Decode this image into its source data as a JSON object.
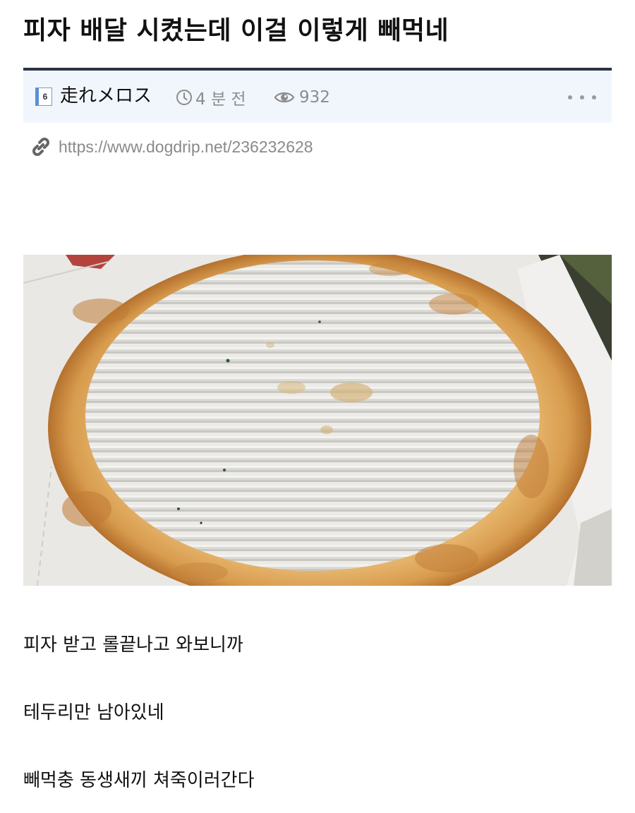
{
  "post": {
    "title": "피자 배달 시켰는데 이걸 이렇게 빼먹네",
    "meta": {
      "level_badge": "6",
      "author": "走れメロス",
      "time_ago": "4 분 전",
      "views": "932"
    },
    "link_url": "https://www.dogdrip.net/236232628",
    "body": [
      "피자 받고 롤끝나고 와보니까",
      "테두리만 남아있네",
      "빼먹충 동생새끼 쳐죽이러간다"
    ]
  },
  "icons": {
    "level": "level-badge-icon",
    "time": "clock-icon",
    "views": "eye-icon",
    "more": "more-icon",
    "link": "link-icon"
  },
  "colors": {
    "accent_border": "#2a3442",
    "meta_background": "#f1f6fd",
    "muted_text": "#8c8c8c",
    "title_text": "#111111"
  }
}
